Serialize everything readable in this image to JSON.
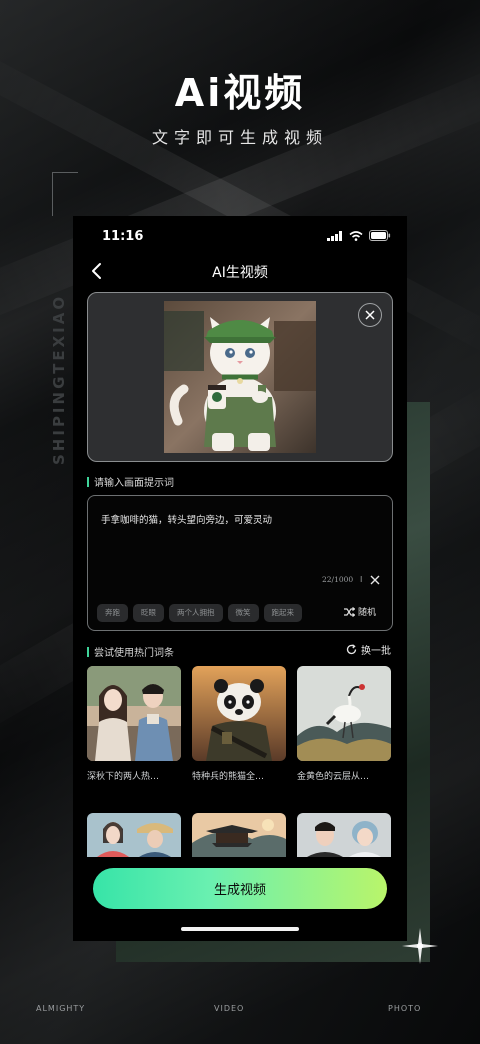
{
  "poster": {
    "title": "Ai视频",
    "subtitle": "文字即可生成视频",
    "vertical_text": "SHIPINGTEXIAO",
    "bottom_labels": [
      "ALMIGHTY",
      "VIDEO",
      "PHOTO"
    ]
  },
  "status_bar": {
    "time": "11:16"
  },
  "nav": {
    "title": "AI生视频"
  },
  "prompt_section": {
    "label": "请输入画面提示词",
    "text": "手拿咖啡的猫，转头望向旁边，可爱灵动",
    "char_count": "22/1000",
    "separator": "I",
    "chips": [
      "奔跑",
      "眨眼",
      "两个人拥抱",
      "微笑",
      "跑起来"
    ],
    "shuffle_label": "随机"
  },
  "hot_section": {
    "label": "尝试使用热门词条",
    "refresh_label": "换一批",
    "items": [
      {
        "caption": "深秋下的两人热…"
      },
      {
        "caption": "特种兵的熊猫全…"
      },
      {
        "caption": "金黄色的云层从…"
      }
    ]
  },
  "generate_button": {
    "label": "生成视频"
  },
  "colors": {
    "accent_start": "#37e4a8",
    "accent_end": "#b9f56a",
    "section_bar": "#3fd49a"
  }
}
